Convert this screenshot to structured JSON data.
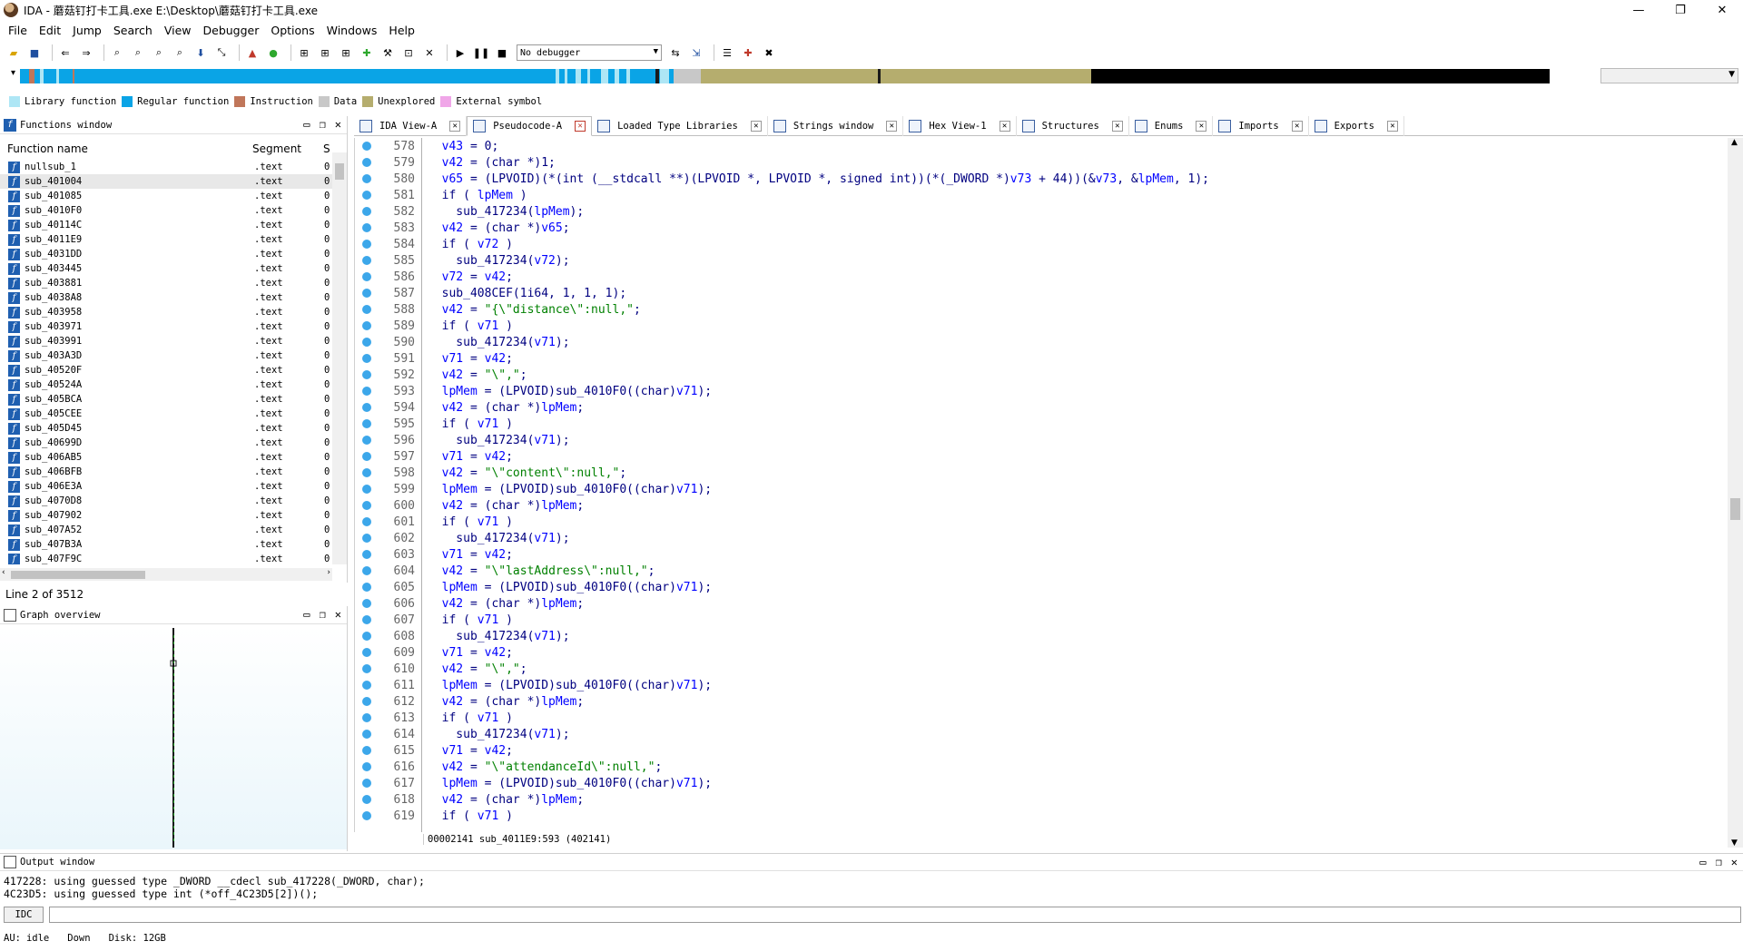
{
  "window": {
    "title": "IDA - 蘑菇钉打卡工具.exe E:\\Desktop\\蘑菇钉打卡工具.exe",
    "minimize": "—",
    "maximize": "❐",
    "close": "✕"
  },
  "menu": [
    "File",
    "Edit",
    "Jump",
    "Search",
    "View",
    "Debugger",
    "Options",
    "Windows",
    "Help"
  ],
  "toolbar": {
    "debugger_select": "No debugger"
  },
  "legend": [
    {
      "label": "Library function",
      "color": "#aee6f5"
    },
    {
      "label": "Regular function",
      "color": "#0aa4e6"
    },
    {
      "label": "Instruction",
      "color": "#c0765a"
    },
    {
      "label": "Data",
      "color": "#c8c8c8"
    },
    {
      "label": "Unexplored",
      "color": "#b5ad6e"
    },
    {
      "label": "External symbol",
      "color": "#f0a6e8"
    }
  ],
  "functions_window": {
    "title": "Functions window",
    "columns": [
      "Function name",
      "Segment",
      "S"
    ],
    "rows": [
      {
        "name": "nullsub_1",
        "segment": ".text",
        "s": "0"
      },
      {
        "name": "sub_401004",
        "segment": ".text",
        "s": "0"
      },
      {
        "name": "sub_401085",
        "segment": ".text",
        "s": "0"
      },
      {
        "name": "sub_4010F0",
        "segment": ".text",
        "s": "0"
      },
      {
        "name": "sub_40114C",
        "segment": ".text",
        "s": "0"
      },
      {
        "name": "sub_4011E9",
        "segment": ".text",
        "s": "0"
      },
      {
        "name": "sub_4031DD",
        "segment": ".text",
        "s": "0"
      },
      {
        "name": "sub_403445",
        "segment": ".text",
        "s": "0"
      },
      {
        "name": "sub_403881",
        "segment": ".text",
        "s": "0"
      },
      {
        "name": "sub_4038A8",
        "segment": ".text",
        "s": "0"
      },
      {
        "name": "sub_403958",
        "segment": ".text",
        "s": "0"
      },
      {
        "name": "sub_403971",
        "segment": ".text",
        "s": "0"
      },
      {
        "name": "sub_403991",
        "segment": ".text",
        "s": "0"
      },
      {
        "name": "sub_403A3D",
        "segment": ".text",
        "s": "0"
      },
      {
        "name": "sub_40520F",
        "segment": ".text",
        "s": "0"
      },
      {
        "name": "sub_40524A",
        "segment": ".text",
        "s": "0"
      },
      {
        "name": "sub_405BCA",
        "segment": ".text",
        "s": "0"
      },
      {
        "name": "sub_405CEE",
        "segment": ".text",
        "s": "0"
      },
      {
        "name": "sub_405D45",
        "segment": ".text",
        "s": "0"
      },
      {
        "name": "sub_40699D",
        "segment": ".text",
        "s": "0"
      },
      {
        "name": "sub_406AB5",
        "segment": ".text",
        "s": "0"
      },
      {
        "name": "sub_406BFB",
        "segment": ".text",
        "s": "0"
      },
      {
        "name": "sub_406E3A",
        "segment": ".text",
        "s": "0"
      },
      {
        "name": "sub_4070D8",
        "segment": ".text",
        "s": "0"
      },
      {
        "name": "sub_407902",
        "segment": ".text",
        "s": "0"
      },
      {
        "name": "sub_407A52",
        "segment": ".text",
        "s": "0"
      },
      {
        "name": "sub_407B3A",
        "segment": ".text",
        "s": "0"
      },
      {
        "name": "sub_407F9C",
        "segment": ".text",
        "s": "0"
      }
    ],
    "selected_index": 1,
    "status": "Line 2 of 3512"
  },
  "graph_overview": {
    "title": "Graph overview"
  },
  "tabs": [
    {
      "label": "IDA View-A",
      "active": false
    },
    {
      "label": "Pseudocode-A",
      "active": true
    },
    {
      "label": "Loaded Type Libraries",
      "active": false
    },
    {
      "label": "Strings window",
      "active": false
    },
    {
      "label": "Hex View-1",
      "active": false
    },
    {
      "label": "Structures",
      "active": false
    },
    {
      "label": "Enums",
      "active": false
    },
    {
      "label": "Imports",
      "active": false
    },
    {
      "label": "Exports",
      "active": false
    }
  ],
  "code": [
    {
      "n": "578",
      "t": "  v43 = 0;"
    },
    {
      "n": "579",
      "t": "  v42 = (char *)1;"
    },
    {
      "n": "580",
      "t": "  v65 = (LPVOID)(*(int (__stdcall **)(LPVOID *, LPVOID *, signed int))(*(_DWORD *)v73 + 44))(&v73, &lpMem, 1);"
    },
    {
      "n": "581",
      "t": "  if ( lpMem )"
    },
    {
      "n": "582",
      "t": "    sub_417234(lpMem);"
    },
    {
      "n": "583",
      "t": "  v42 = (char *)v65;"
    },
    {
      "n": "584",
      "t": "  if ( v72 )"
    },
    {
      "n": "585",
      "t": "    sub_417234(v72);"
    },
    {
      "n": "586",
      "t": "  v72 = v42;"
    },
    {
      "n": "587",
      "t": "  sub_408CEF(1i64, 1, 1, 1);"
    },
    {
      "n": "588",
      "t": "  v42 = \"{\\\"distance\\\":null,\";"
    },
    {
      "n": "589",
      "t": "  if ( v71 )"
    },
    {
      "n": "590",
      "t": "    sub_417234(v71);"
    },
    {
      "n": "591",
      "t": "  v71 = v42;"
    },
    {
      "n": "592",
      "t": "  v42 = \"\\\",\";"
    },
    {
      "n": "593",
      "t": "  lpMem = (LPVOID)sub_4010F0((char)v71);"
    },
    {
      "n": "594",
      "t": "  v42 = (char *)lpMem;"
    },
    {
      "n": "595",
      "t": "  if ( v71 )"
    },
    {
      "n": "596",
      "t": "    sub_417234(v71);"
    },
    {
      "n": "597",
      "t": "  v71 = v42;"
    },
    {
      "n": "598",
      "t": "  v42 = \"\\\"content\\\":null,\";"
    },
    {
      "n": "599",
      "t": "  lpMem = (LPVOID)sub_4010F0((char)v71);"
    },
    {
      "n": "600",
      "t": "  v42 = (char *)lpMem;"
    },
    {
      "n": "601",
      "t": "  if ( v71 )"
    },
    {
      "n": "602",
      "t": "    sub_417234(v71);"
    },
    {
      "n": "603",
      "t": "  v71 = v42;"
    },
    {
      "n": "604",
      "t": "  v42 = \"\\\"lastAddress\\\":null,\";"
    },
    {
      "n": "605",
      "t": "  lpMem = (LPVOID)sub_4010F0((char)v71);"
    },
    {
      "n": "606",
      "t": "  v42 = (char *)lpMem;"
    },
    {
      "n": "607",
      "t": "  if ( v71 )"
    },
    {
      "n": "608",
      "t": "    sub_417234(v71);"
    },
    {
      "n": "609",
      "t": "  v71 = v42;"
    },
    {
      "n": "610",
      "t": "  v42 = \"\\\",\";"
    },
    {
      "n": "611",
      "t": "  lpMem = (LPVOID)sub_4010F0((char)v71);"
    },
    {
      "n": "612",
      "t": "  v42 = (char *)lpMem;"
    },
    {
      "n": "613",
      "t": "  if ( v71 )"
    },
    {
      "n": "614",
      "t": "    sub_417234(v71);"
    },
    {
      "n": "615",
      "t": "  v71 = v42;"
    },
    {
      "n": "616",
      "t": "  v42 = \"\\\"attendanceId\\\":null,\";"
    },
    {
      "n": "617",
      "t": "  lpMem = (LPVOID)sub_4010F0((char)v71);"
    },
    {
      "n": "618",
      "t": "  v42 = (char *)lpMem;"
    },
    {
      "n": "619",
      "t": "  if ( v71 )"
    }
  ],
  "code_status": "00002141 sub_4011E9:593 (402141)",
  "output_window": {
    "title": "Output window",
    "lines": [
      "417228: using guessed type _DWORD __cdecl sub_417228(_DWORD, char);",
      "4C23D5: using guessed type int (*off_4C23D5[2])();"
    ]
  },
  "idc_label": "IDC",
  "statusbar": {
    "au": "AU:",
    "state": "idle",
    "direction": "Down",
    "disk": "Disk: 12GB"
  }
}
